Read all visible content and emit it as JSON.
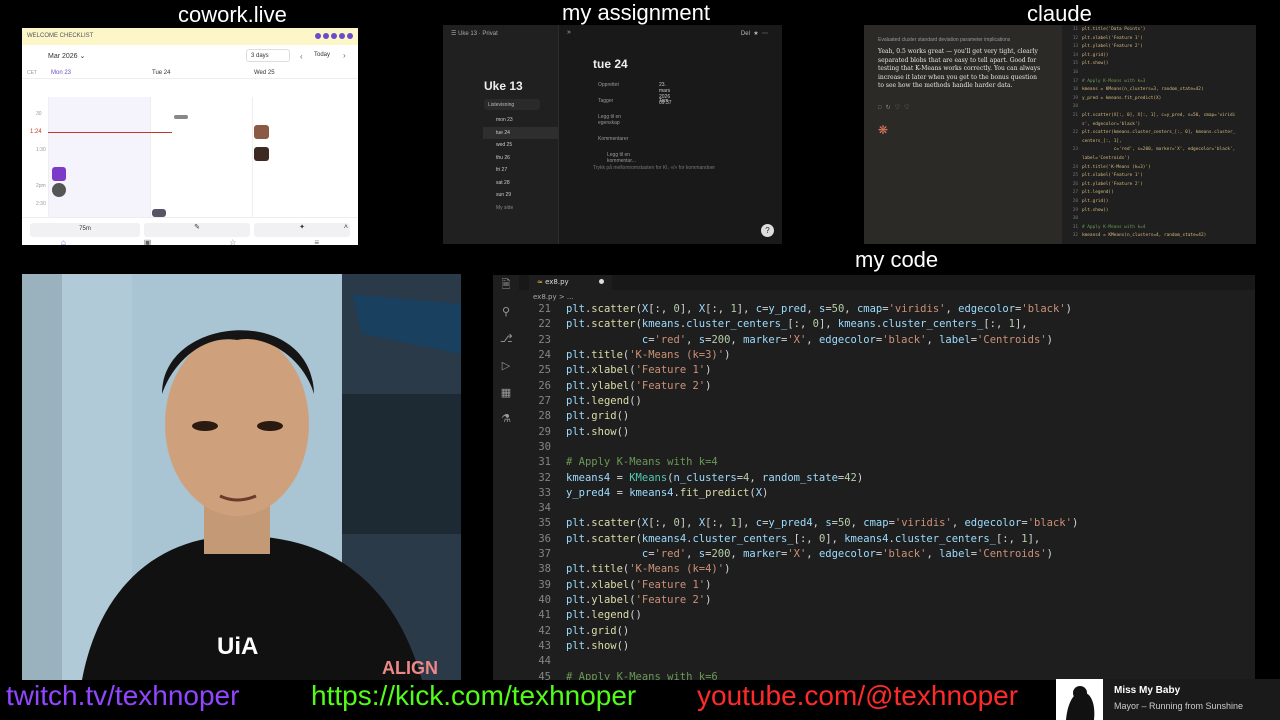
{
  "labels": {
    "cowork": "cowork.live",
    "assignment": "my assignment",
    "claude": "claude",
    "code": "my code"
  },
  "cowork": {
    "banner": "WELCOME CHECKLIST",
    "month": "Mar 2026",
    "view": "3 days",
    "today": "Today",
    "days": [
      "Mon 23",
      "Tue 24",
      "Wed 25"
    ],
    "now_label": "1:24",
    "times": [
      "30",
      "1:30",
      "2pm",
      "2:30"
    ],
    "timer": "75m",
    "accent": "#6b4bc7",
    "tabbar_icons": [
      "home-icon",
      "calendar-icon",
      "star-icon",
      "menu-icon"
    ]
  },
  "assignment": {
    "breadcrumb": "Uke 13 · Privat",
    "share": "Del",
    "week_title": "Uke 13",
    "list_view": "Listevisning",
    "days": [
      "mon 23",
      "tue 24",
      "wed 25",
      "thu 26",
      "fri 27",
      "sat 28",
      "sun 29",
      "My side"
    ],
    "page_title": "tue 24",
    "props": [
      {
        "key": "Opprettet",
        "value": "23. mars 2026 09:37"
      },
      {
        "key": "Tagger",
        "value": "Tom"
      }
    ],
    "add_property": "Legg til en egenskap",
    "comments_label": "Kommentarer",
    "comment_placeholder": "Legg til en kommentar...",
    "editor_prompt": "Trykk på mellomromstasten for KI, «/» for kommandoer"
  },
  "claude": {
    "chat_header": "Evaluated cluster standard deviation parameter implications",
    "message": "Yeah, 0.5 works great — you'll get very tight, clearly separated blobs that are easy to tell apart. Good for testing that K-Means works correctly. You can always increase it later when you get to the bonus question to see how the methods handle harder data.",
    "code_lines": [
      {
        "n": "11",
        "t": "plt.title('Data Points')"
      },
      {
        "n": "12",
        "t": "plt.xlabel('Feature 1')"
      },
      {
        "n": "13",
        "t": "plt.ylabel('Feature 2')"
      },
      {
        "n": "14",
        "t": "plt.grid()"
      },
      {
        "n": "15",
        "t": "plt.show()"
      },
      {
        "n": "16",
        "t": ""
      },
      {
        "n": "17",
        "t": "# Apply K-Means with k=3"
      },
      {
        "n": "18",
        "t": "kmeans = KMeans(n_clusters=3, random_state=42)"
      },
      {
        "n": "19",
        "t": "y_pred = kmeans.fit_predict(X)"
      },
      {
        "n": "20",
        "t": ""
      },
      {
        "n": "21",
        "t": "plt.scatter(X[:, 0], X[:, 1], c=y_pred, s=50, cmap='viridi"
      },
      {
        "n": "",
        "t": "s', edgecolor='black')"
      },
      {
        "n": "22",
        "t": "plt.scatter(kmeans.cluster_centers_[:, 0], kmeans.cluster_"
      },
      {
        "n": "",
        "t": "centers_[:, 1],"
      },
      {
        "n": "23",
        "t": "            c='red', s=200, marker='X', edgecolor='black',"
      },
      {
        "n": "",
        "t": "label='Centroids')"
      },
      {
        "n": "24",
        "t": "plt.title('K-Means (k=3)')"
      },
      {
        "n": "25",
        "t": "plt.xlabel('Feature 1')"
      },
      {
        "n": "26",
        "t": "plt.ylabel('Feature 2')"
      },
      {
        "n": "27",
        "t": "plt.legend()"
      },
      {
        "n": "28",
        "t": "plt.grid()"
      },
      {
        "n": "29",
        "t": "plt.show()"
      },
      {
        "n": "30",
        "t": ""
      },
      {
        "n": "31",
        "t": "# Apply K-Means with k=4"
      },
      {
        "n": "32",
        "t": "kmeans4 = KMeans(n_clusters=4, random_state=42)"
      }
    ]
  },
  "code": {
    "tab": "ex8.py",
    "breadcrumb": "ex8.py > ...",
    "lines": [
      {
        "n": "21",
        "h": "<span class='var'>plt</span>.<span class='fn'>scatter</span>(<span class='var'>X</span>[:, <span class='num'>0</span>], <span class='var'>X</span>[:, <span class='num'>1</span>], <span class='var'>c</span>=<span class='var'>y_pred</span>, <span class='var'>s</span>=<span class='num'>50</span>, <span class='var'>cmap</span>=<span class='str'>'viridis'</span>, <span class='var'>edgecolor</span>=<span class='str'>'black'</span>)"
      },
      {
        "n": "22",
        "h": "<span class='var'>plt</span>.<span class='fn'>scatter</span>(<span class='var'>kmeans</span>.<span class='var'>cluster_centers_</span>[:, <span class='num'>0</span>], <span class='var'>kmeans</span>.<span class='var'>cluster_centers_</span>[:, <span class='num'>1</span>],"
      },
      {
        "n": "23",
        "h": "            <span class='var'>c</span>=<span class='str'>'red'</span>, <span class='var'>s</span>=<span class='num'>200</span>, <span class='var'>marker</span>=<span class='str'>'X'</span>, <span class='var'>edgecolor</span>=<span class='str'>'black'</span>, <span class='var'>label</span>=<span class='str'>'Centroids'</span>)"
      },
      {
        "n": "24",
        "h": "<span class='var'>plt</span>.<span class='fn'>title</span>(<span class='str'>'K-Means (k=3)'</span>)"
      },
      {
        "n": "25",
        "h": "<span class='var'>plt</span>.<span class='fn'>xlabel</span>(<span class='str'>'Feature 1'</span>)"
      },
      {
        "n": "26",
        "h": "<span class='var'>plt</span>.<span class='fn'>ylabel</span>(<span class='str'>'Feature 2'</span>)"
      },
      {
        "n": "27",
        "h": "<span class='var'>plt</span>.<span class='fn'>legend</span>()"
      },
      {
        "n": "28",
        "h": "<span class='var'>plt</span>.<span class='fn'>grid</span>()"
      },
      {
        "n": "29",
        "h": "<span class='var'>plt</span>.<span class='fn'>show</span>()"
      },
      {
        "n": "30",
        "h": ""
      },
      {
        "n": "31",
        "h": "<span class='cm'># Apply K-Means with k=4</span>"
      },
      {
        "n": "32",
        "h": "<span class='var'>kmeans4</span> = <span class='cls'>KMeans</span>(<span class='var'>n_clusters</span>=<span class='num'>4</span>, <span class='var'>random_state</span>=<span class='num'>42</span>)"
      },
      {
        "n": "33",
        "h": "<span class='var'>y_pred4</span> = <span class='var'>kmeans4</span>.<span class='fn'>fit_predict</span>(<span class='var'>X</span>)"
      },
      {
        "n": "34",
        "h": ""
      },
      {
        "n": "35",
        "h": "<span class='var'>plt</span>.<span class='fn'>scatter</span>(<span class='var'>X</span>[:, <span class='num'>0</span>], <span class='var'>X</span>[:, <span class='num'>1</span>], <span class='var'>c</span>=<span class='var'>y_pred4</span>, <span class='var'>s</span>=<span class='num'>50</span>, <span class='var'>cmap</span>=<span class='str'>'viridis'</span>, <span class='var'>edgecolor</span>=<span class='str'>'black'</span>)"
      },
      {
        "n": "36",
        "h": "<span class='var'>plt</span>.<span class='fn'>scatter</span>(<span class='var'>kmeans4</span>.<span class='var'>cluster_centers_</span>[:, <span class='num'>0</span>], <span class='var'>kmeans4</span>.<span class='var'>cluster_centers_</span>[:, <span class='num'>1</span>],"
      },
      {
        "n": "37",
        "h": "            <span class='var'>c</span>=<span class='str'>'red'</span>, <span class='var'>s</span>=<span class='num'>200</span>, <span class='var'>marker</span>=<span class='str'>'X'</span>, <span class='var'>edgecolor</span>=<span class='str'>'black'</span>, <span class='var'>label</span>=<span class='str'>'Centroids'</span>)"
      },
      {
        "n": "38",
        "h": "<span class='var'>plt</span>.<span class='fn'>title</span>(<span class='str'>'K-Means (k=4)'</span>)"
      },
      {
        "n": "39",
        "h": "<span class='var'>plt</span>.<span class='fn'>xlabel</span>(<span class='str'>'Feature 1'</span>)"
      },
      {
        "n": "40",
        "h": "<span class='var'>plt</span>.<span class='fn'>ylabel</span>(<span class='str'>'Feature 2'</span>)"
      },
      {
        "n": "41",
        "h": "<span class='var'>plt</span>.<span class='fn'>legend</span>()"
      },
      {
        "n": "42",
        "h": "<span class='var'>plt</span>.<span class='fn'>grid</span>()"
      },
      {
        "n": "43",
        "h": "<span class='var'>plt</span>.<span class='fn'>show</span>()"
      },
      {
        "n": "44",
        "h": ""
      },
      {
        "n": "45",
        "h": "<span class='cm'># Apply K-Means with k=6</span>"
      }
    ]
  },
  "footer": {
    "twitch": "twitch.tv/texhnoper",
    "kick": "https://kick.com/texhnoper",
    "youtube": "youtube.com/@texhnoper",
    "song": "Miss My Baby",
    "artist": "Mayor – Running from Sunshine",
    "twitch_color": "#9146ff",
    "kick_color": "#53fc18",
    "youtube_color": "#ff2a2a"
  },
  "webcam": {
    "shirt_text": "UiA",
    "shirt_text2": "ALIGN"
  }
}
